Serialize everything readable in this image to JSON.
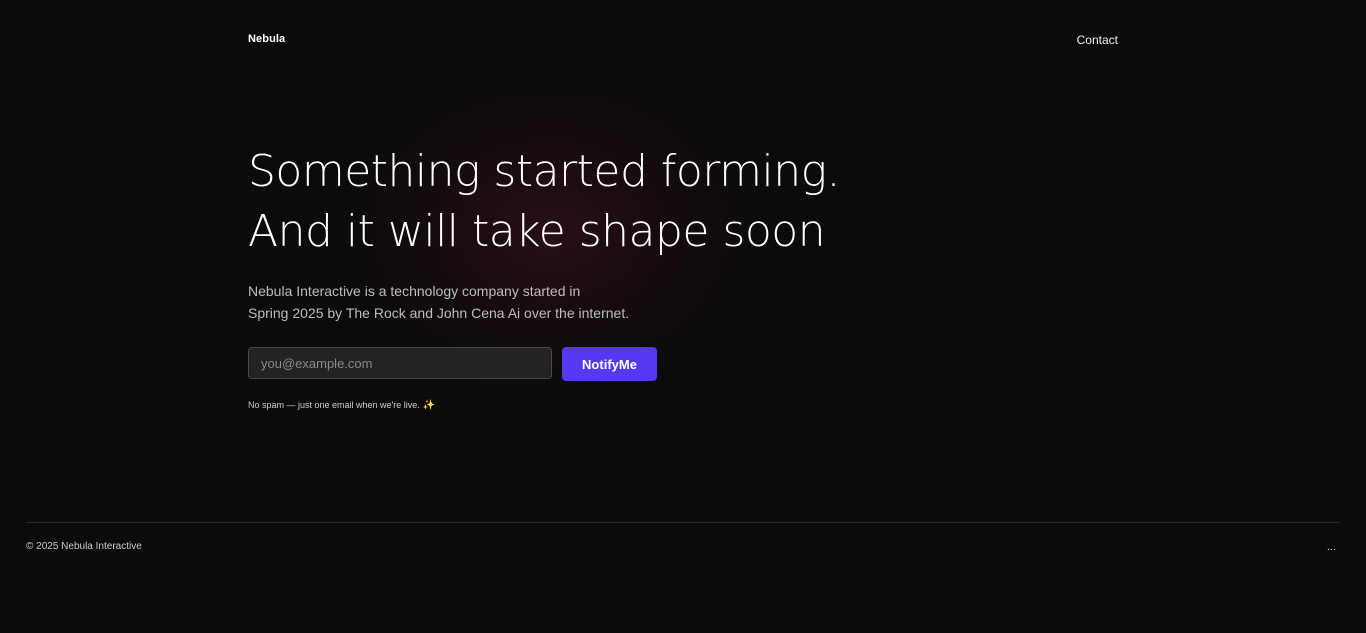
{
  "header": {
    "brand": "Nebula",
    "nav_contact": "Contact"
  },
  "hero": {
    "headline_line1": "Something started forming.",
    "headline_line2": "And it will take shape soon",
    "intro_line1": "Nebula Interactive is a technology company started in",
    "intro_line2": "Spring 2025 by The Rock and John Cena Ai  over the internet."
  },
  "signup": {
    "email_placeholder": "you@example.com",
    "button_label": "NotifyMe",
    "note": "No spam — just one email when we're live.",
    "note_icon": "sparkles-icon"
  },
  "footer": {
    "copyright": "© 2025 Nebula Interactive",
    "more_label": "...",
    "more_icon": "more-icon"
  },
  "colors": {
    "background": "#0b0b0b",
    "accent": "#5538f0",
    "glow": "#5a1228"
  }
}
